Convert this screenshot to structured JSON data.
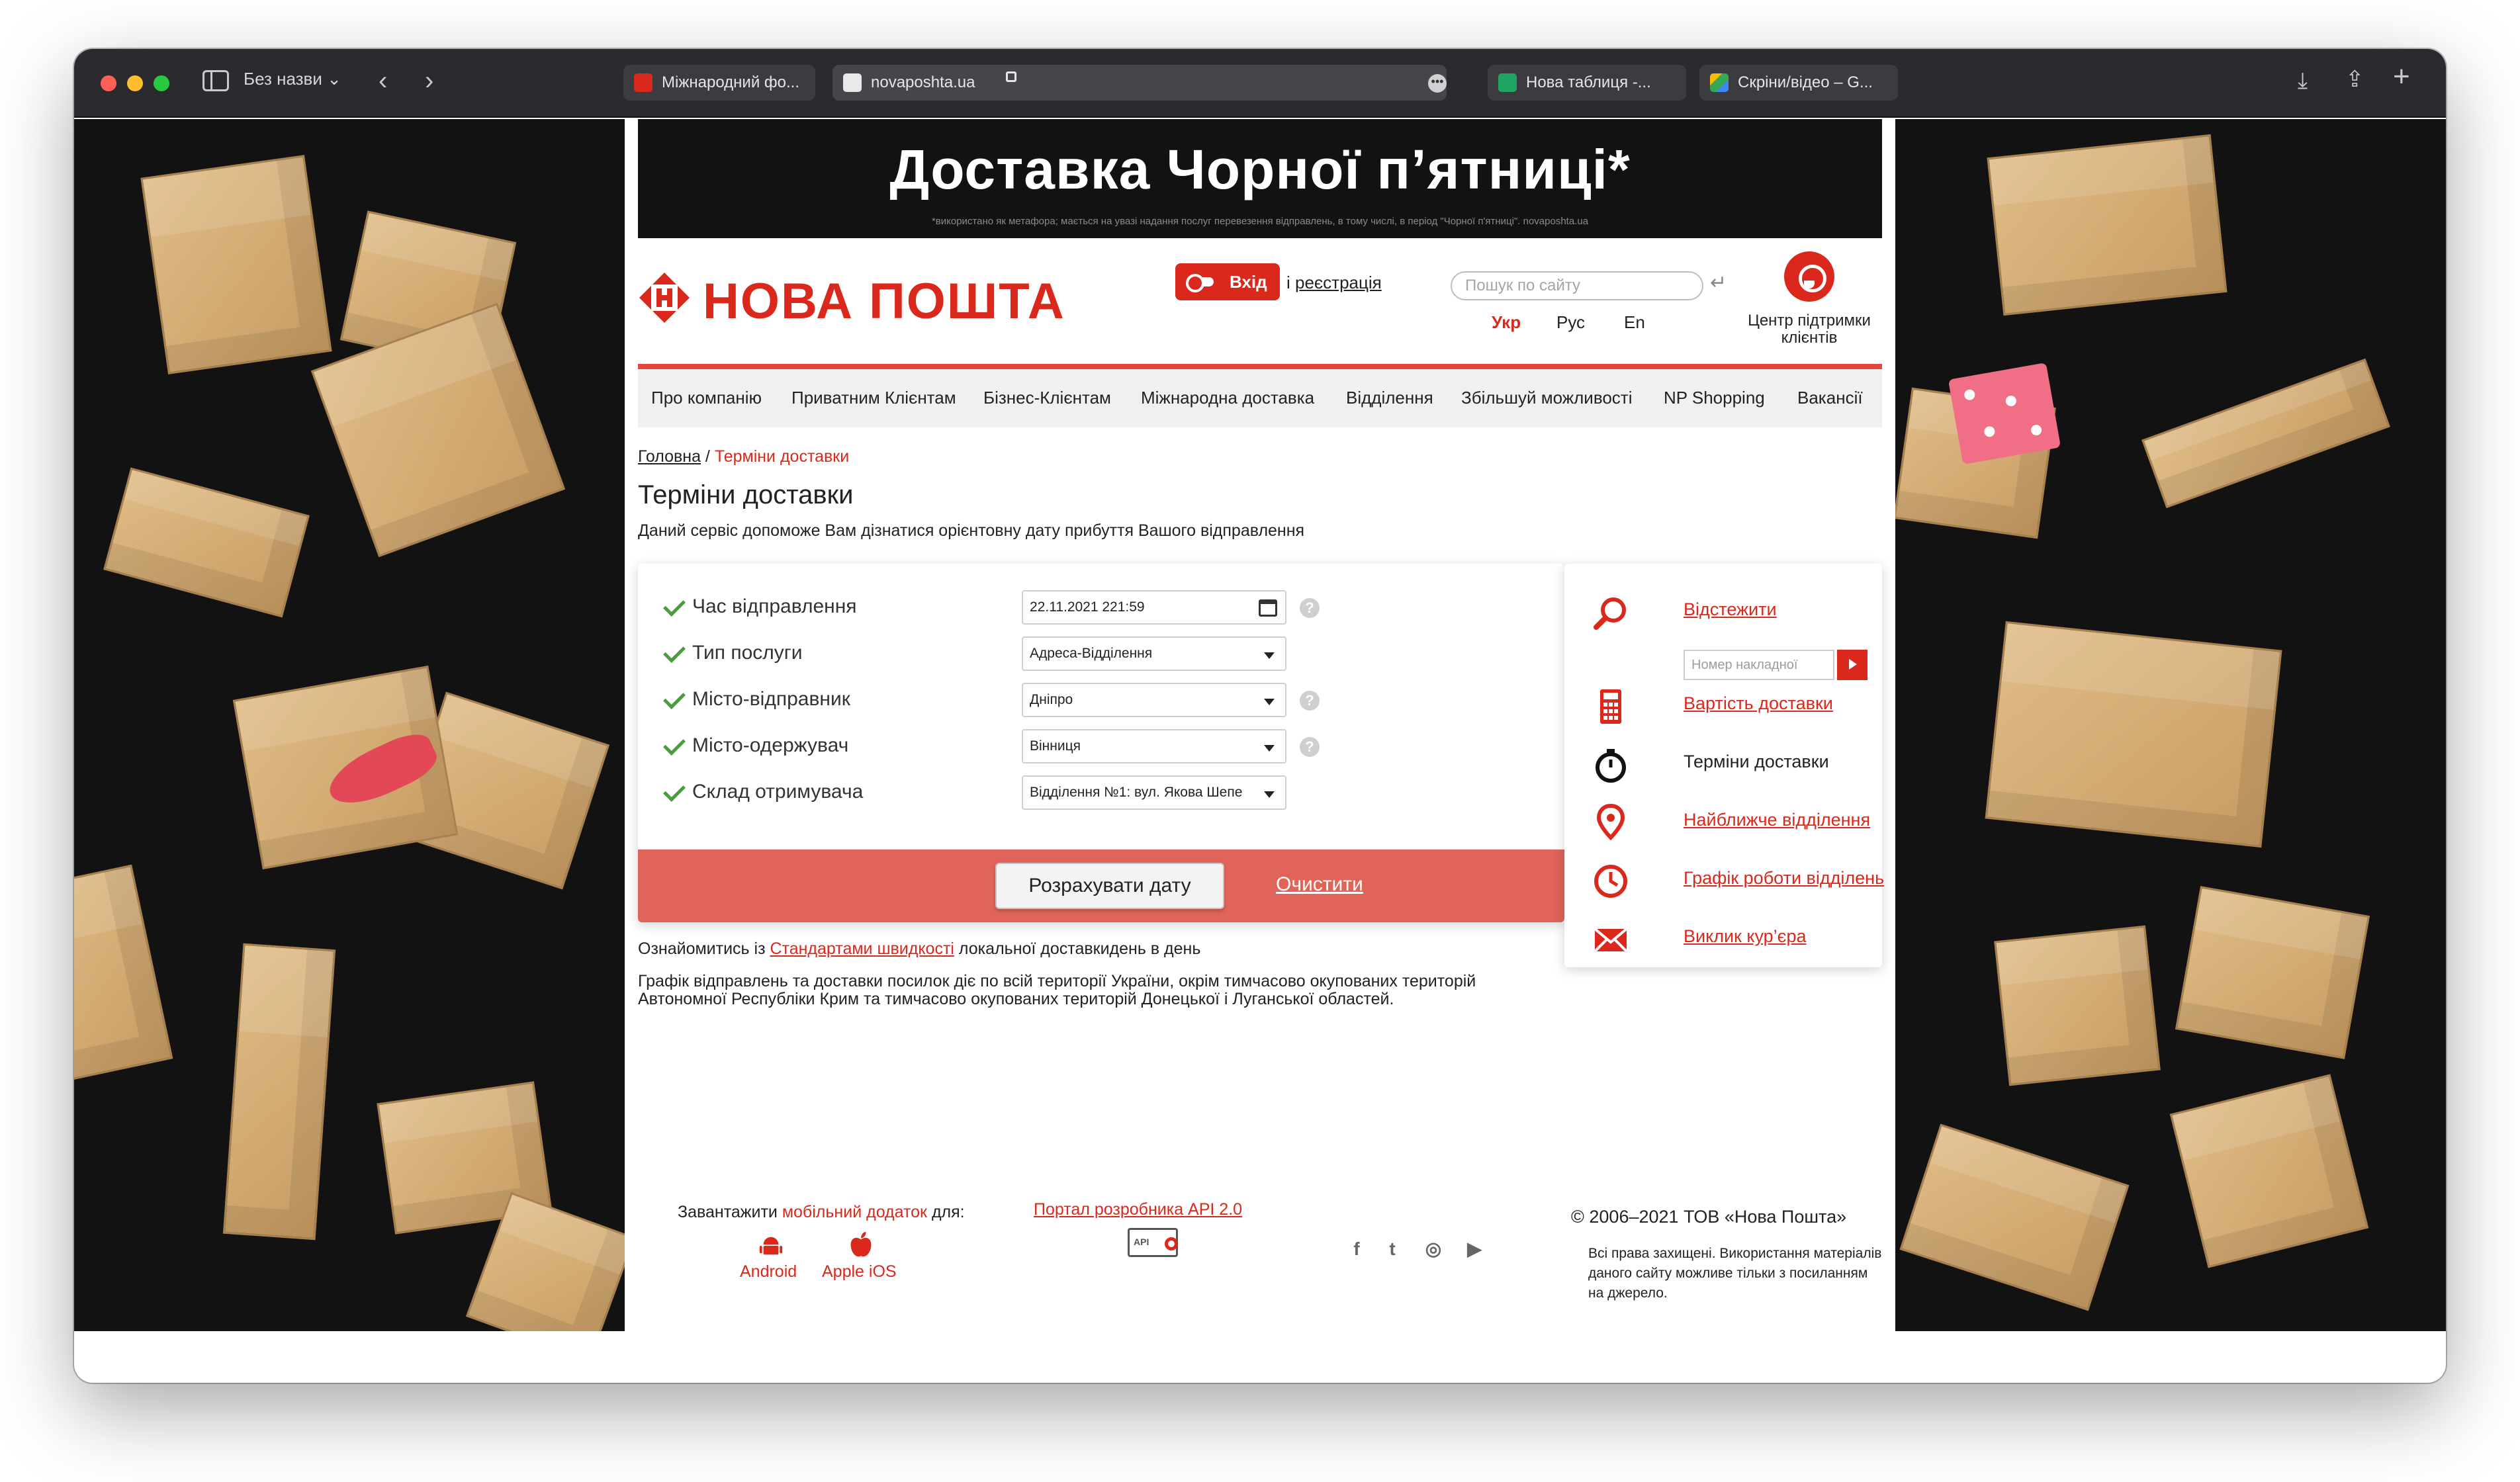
{
  "browser": {
    "window_title": "Без назви ⌄",
    "tabs": [
      {
        "label": "Міжнародний фо..."
      },
      {
        "label": "novaposhta.ua"
      },
      {
        "label": "Нова таблиця -..."
      },
      {
        "label": "Скріни/відео – G..."
      }
    ],
    "address": "novaposhta.ua"
  },
  "promo": {
    "title": "Доставка Чорної п’ятниці*",
    "note": "*використано як метафора; мається на увазі надання послуг перевезення відправлень, в тому числі, в період \"Чорної п'ятниці\". novaposhta.ua"
  },
  "header": {
    "logo_text": "НОВА ПОШТА",
    "login_label": "Вхід",
    "register_prefix": "і ",
    "register_label": "реєстрація",
    "search_placeholder": "Пошук по сайту",
    "languages": {
      "ukr": "Укр",
      "rus": "Рус",
      "en": "En"
    },
    "support_label": "Центр підтримки клієнтів"
  },
  "nav": {
    "items": [
      "Про компанію",
      "Приватним Клієнтам",
      "Бізнес-Клієнтам",
      "Міжнародна доставка",
      "Відділення",
      "Збільшуй можливості",
      "NP Shopping",
      "Вакансії"
    ]
  },
  "breadcrumb": {
    "home": "Головна",
    "separator": " / ",
    "current": "Терміни доставки"
  },
  "page": {
    "title": "Терміни доставки",
    "description": "Даний сервіс допоможе Вам дізнатися орієнтовну дату прибуття Вашого відправлення"
  },
  "form": {
    "rows": [
      {
        "label": "Час відправлення",
        "value": "22.11.2021 221:59"
      },
      {
        "label": "Тип послуги",
        "value": "Адреса-Відділення"
      },
      {
        "label": "Місто-відправник",
        "value": "Дніпро"
      },
      {
        "label": "Місто-одержувач",
        "value": "Вінниця"
      },
      {
        "label": "Склад отримувача",
        "value": "Відділення №1: вул. Якова Шепе"
      }
    ],
    "help_symbol": "?",
    "calculate_label": "Розрахувати дату",
    "clear_label": "Очистити"
  },
  "notes": {
    "standards_prefix": "Ознайомитись із ",
    "standards_link": "Стандартами швидкості",
    "standards_suffix": " локальної доставкидень в день",
    "territory": "Графік відправлень та доставки посилок діє по всій території України, окрім тимчасово окупованих територій Автономної Республіки Крим та тимчасово окупованих територій Донецької і Луганської областей."
  },
  "sidebar": {
    "track_label": "Відстежити",
    "track_placeholder": "Номер накладної",
    "items": [
      {
        "label": "Вартість доставки",
        "icon": "calculator-icon"
      },
      {
        "label": "Терміни доставки",
        "icon": "stopwatch-icon"
      },
      {
        "label": "Найближче відділення",
        "icon": "map-pin-icon"
      },
      {
        "label": "Графік роботи відділень",
        "icon": "clock-icon"
      },
      {
        "label": "Виклик кур’єра",
        "icon": "envelope-icon"
      }
    ]
  },
  "footer": {
    "app_prefix": "Завантажити ",
    "app_link": "мобільний додаток",
    "app_suffix": " для:",
    "android_label": "Android",
    "ios_label": "Apple iOS",
    "api_link": "Портал розробника API 2.0",
    "social": [
      {
        "icon": "facebook-icon",
        "glyph": "f"
      },
      {
        "icon": "twitter-icon",
        "glyph": "t"
      },
      {
        "icon": "instagram-icon",
        "glyph": "◎"
      },
      {
        "icon": "youtube-icon",
        "glyph": "▶"
      }
    ],
    "copyright": "© 2006–2021 ТОВ «Нова Пошта»",
    "rights": "Всі права захищені. Використання матеріалів даного сайту можливе тільки з посиланням на джерело."
  },
  "colors": {
    "brand_red": "#da291c",
    "action_bar": "#e0645a",
    "check_green": "#4a9d3b",
    "promo_bg": "#121212"
  }
}
